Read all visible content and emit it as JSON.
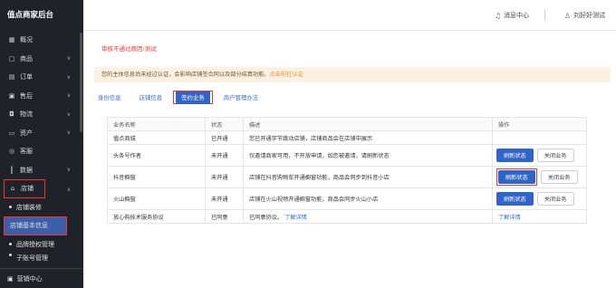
{
  "sidebar": {
    "brand": "值点商家后台",
    "items": [
      {
        "label": "概况",
        "icon": "grid-icon"
      },
      {
        "label": "商品",
        "icon": "bag-icon"
      },
      {
        "label": "订单",
        "icon": "order-icon"
      },
      {
        "label": "售后",
        "icon": "aftersale-icon"
      },
      {
        "label": "物流",
        "icon": "truck-icon"
      },
      {
        "label": "资产",
        "icon": "wallet-icon"
      },
      {
        "label": "客服",
        "icon": "service-icon"
      },
      {
        "label": "数据",
        "icon": "chart-icon"
      },
      {
        "label": "店铺",
        "icon": "store-icon"
      }
    ],
    "sub_items": [
      "店铺装修",
      "店铺基本信息",
      "品牌授权管理",
      "子账号管理"
    ],
    "bottom": "营销中心"
  },
  "header": {
    "messages": "消息中心",
    "user": "刘好好测试"
  },
  "main": {
    "review_tip": "审核不通过原因:测试",
    "notice": "您的主体信息尚未经过认证，会影响店铺签合同以及部分结算功能。",
    "notice_link": "点击前往认证",
    "tabs": [
      "身份信息",
      "店铺信息",
      "签约业务",
      "商户管理办法"
    ],
    "table": {
      "headers": [
        "业务名称",
        "状态",
        "描述",
        "操作"
      ],
      "rows": [
        {
          "name": "值点商城",
          "status": "已开通",
          "desc": "您已开通字节跳动店铺，店铺商品会在店铺中展示",
          "op": ""
        },
        {
          "name": "头条号作者",
          "status": "未开通",
          "desc": "仅邀请商家可用，不开放申请，如您被邀请，请刷新状态",
          "op": "buttons"
        },
        {
          "name": "抖音橱窗",
          "status": "未开通",
          "desc": "店铺在抖音购物车开通橱窗功能，商品会同步到抖音小店",
          "op": "buttons"
        },
        {
          "name": "火山橱窗",
          "status": "未开通",
          "desc": "店铺在火山视频开通橱窗功能，商品会同步火山小店",
          "op": "buttons"
        },
        {
          "name": "放心购技术服务协议",
          "status": "已同意",
          "desc": "已同意协议。",
          "desc_link": "了解详情",
          "op": "了解详情"
        }
      ],
      "refresh_label": "刷新状态",
      "close_label": "关闭业务"
    }
  }
}
